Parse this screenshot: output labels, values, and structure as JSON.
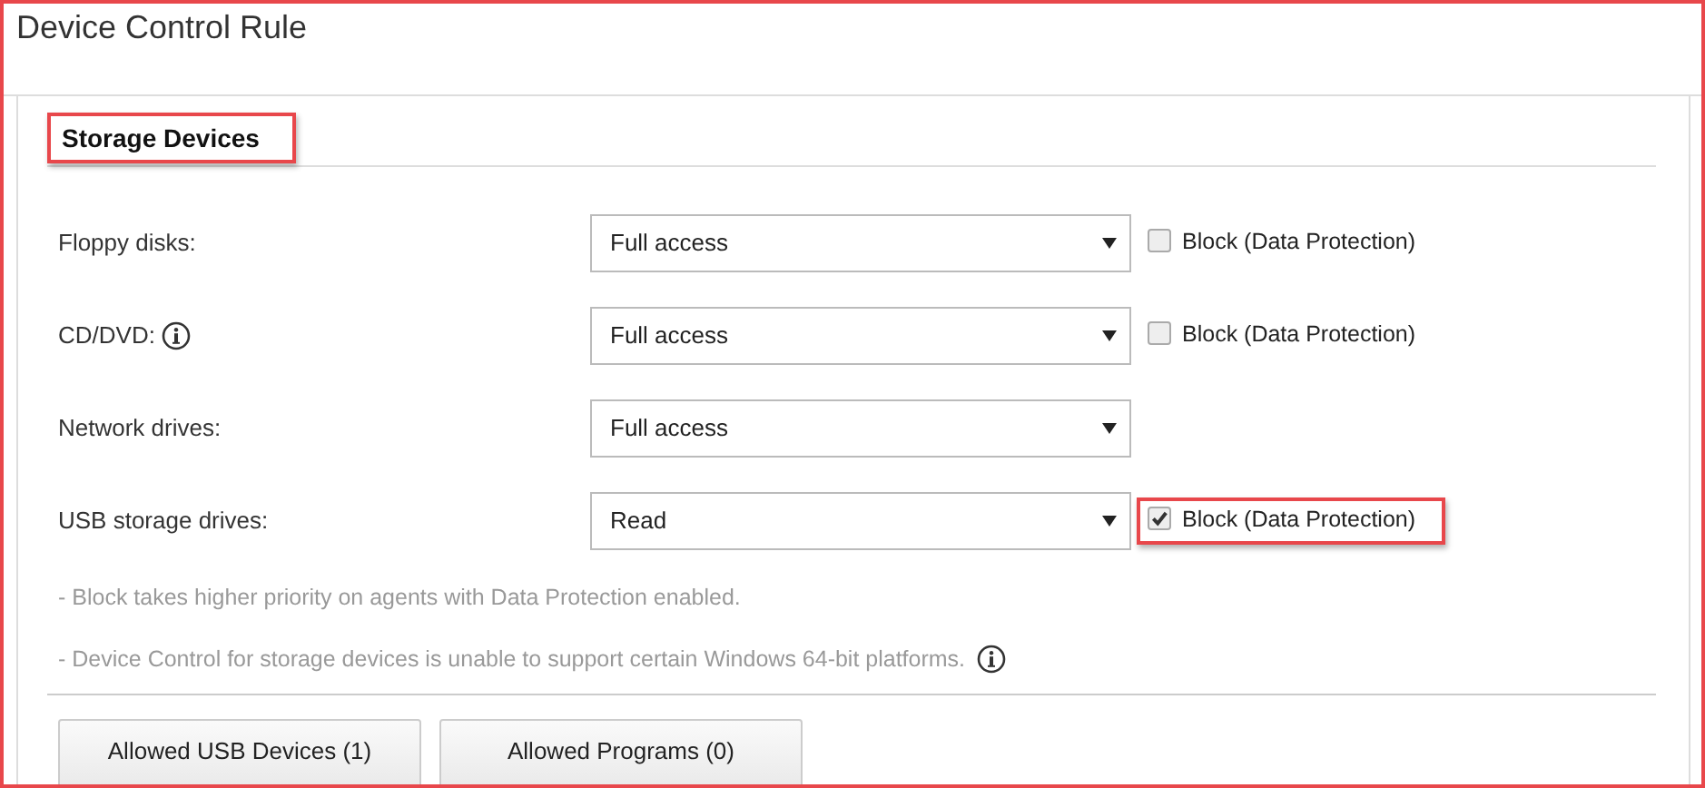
{
  "window": {
    "title": "Device Control Rule"
  },
  "section": {
    "title": "Storage Devices",
    "highlighted": true
  },
  "rows": [
    {
      "label": "Floppy disks:",
      "info": false,
      "value": "Full access",
      "block": {
        "label": "Block (Data Protection)",
        "checked": false,
        "highlighted": false
      }
    },
    {
      "label": "CD/DVD:",
      "info": true,
      "value": "Full access",
      "block": {
        "label": "Block (Data Protection)",
        "checked": false,
        "highlighted": false
      }
    },
    {
      "label": "Network drives:",
      "info": false,
      "value": "Full access"
    },
    {
      "label": "USB storage drives:",
      "info": false,
      "value": "Read",
      "block": {
        "label": "Block (Data Protection)",
        "checked": true,
        "highlighted": true
      }
    }
  ],
  "notes": [
    {
      "text": "- Block takes higher priority on agents with Data Protection enabled.",
      "info": false
    },
    {
      "text": "- Device Control for storage devices is unable to support certain Windows 64-bit platforms.",
      "info": true
    }
  ],
  "buttons": [
    "Allowed USB Devices (1)",
    "Allowed Programs (0)"
  ]
}
